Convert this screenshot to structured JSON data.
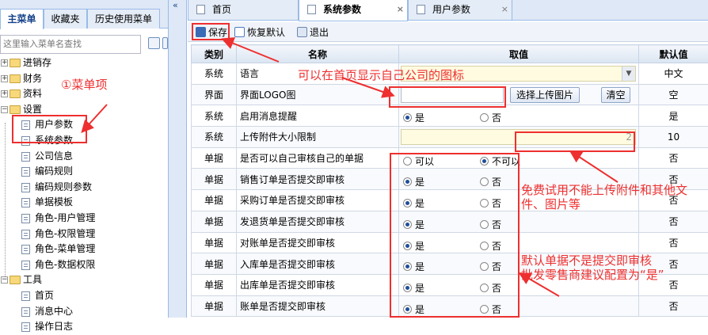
{
  "left_tabs": [
    "主菜单",
    "收藏夹",
    "历史使用菜单"
  ],
  "search": {
    "placeholder": "这里输入菜单名查找"
  },
  "collapse_glyph": "«",
  "tree": [
    {
      "label": "进销存",
      "type": "folder",
      "expand": "+"
    },
    {
      "label": "财务",
      "type": "folder",
      "expand": "+"
    },
    {
      "label": "资料",
      "type": "folder",
      "expand": "+"
    },
    {
      "label": "设置",
      "type": "folder",
      "expand": "−"
    },
    {
      "label": "用户参数",
      "type": "leaf"
    },
    {
      "label": "系统参数",
      "type": "leaf"
    },
    {
      "label": "公司信息",
      "type": "leaf"
    },
    {
      "label": "编码规则",
      "type": "leaf"
    },
    {
      "label": "编码规则参数",
      "type": "leaf"
    },
    {
      "label": "单据模板",
      "type": "leaf"
    },
    {
      "label": "角色-用户管理",
      "type": "leaf"
    },
    {
      "label": "角色-权限管理",
      "type": "leaf"
    },
    {
      "label": "角色-菜单管理",
      "type": "leaf"
    },
    {
      "label": "角色-数据权限",
      "type": "leaf"
    },
    {
      "label": "工具",
      "type": "folder",
      "expand": "−"
    },
    {
      "label": "首页",
      "type": "leaf"
    },
    {
      "label": "消息中心",
      "type": "leaf"
    },
    {
      "label": "操作日志",
      "type": "leaf"
    }
  ],
  "right_tabs": [
    "首页",
    "系统参数",
    "用户参数"
  ],
  "tab_close": "×",
  "toolbar": {
    "save": "保存",
    "reset": "恢复默认",
    "exit": "退出"
  },
  "grid": {
    "headers": [
      "类别",
      "名称",
      "取值",
      "默认值"
    ],
    "rows": [
      {
        "type": "系统",
        "name": "语言",
        "default": "中文"
      },
      {
        "type": "界面",
        "name": "界面LOGO图",
        "default": "空"
      },
      {
        "type": "系统",
        "name": "启用消息提醒",
        "default": "是"
      },
      {
        "type": "系统",
        "name": "上传附件大小限制",
        "default": "10"
      },
      {
        "type": "单据",
        "name": "是否可以自己审核自己的单据",
        "default": "否"
      },
      {
        "type": "单据",
        "name": "销售订单是否提交即审核",
        "default": "否"
      },
      {
        "type": "单据",
        "name": "采购订单是否提交即审核",
        "default": "否"
      },
      {
        "type": "单据",
        "name": "发退货单是否提交即审核",
        "default": "否"
      },
      {
        "type": "单据",
        "name": "对账单是否提交即审核",
        "default": "否"
      },
      {
        "type": "单据",
        "name": "入库单是否提交即审核",
        "default": "否"
      },
      {
        "type": "单据",
        "name": "出库单是否提交即审核",
        "default": "否"
      },
      {
        "type": "单据",
        "name": "账单是否提交即审核",
        "default": "否"
      }
    ],
    "upload_button": "选择上传图片",
    "clear_button": "清空",
    "upload_limit_value": "2",
    "select_arrow": "▼",
    "radio_yes": "是",
    "radio_no": "否",
    "radio_can": "可以",
    "radio_cannot": "不可以"
  },
  "annotations": {
    "menu_item": "①菜单项",
    "logo_note": "可以在首页显示自己公司的图标",
    "trial_note_1": "免费试用不能上传附件和其他文",
    "trial_note_2": "件、图片等",
    "audit_note_1": "默认单据不是提交即审核",
    "audit_note_2": "批发零售商建议配置为“是”"
  },
  "colors": {
    "annotation": "#ee2f2f",
    "tab_bg": "#dfe8f6",
    "border": "#99bbe8",
    "title": "#15428b"
  }
}
